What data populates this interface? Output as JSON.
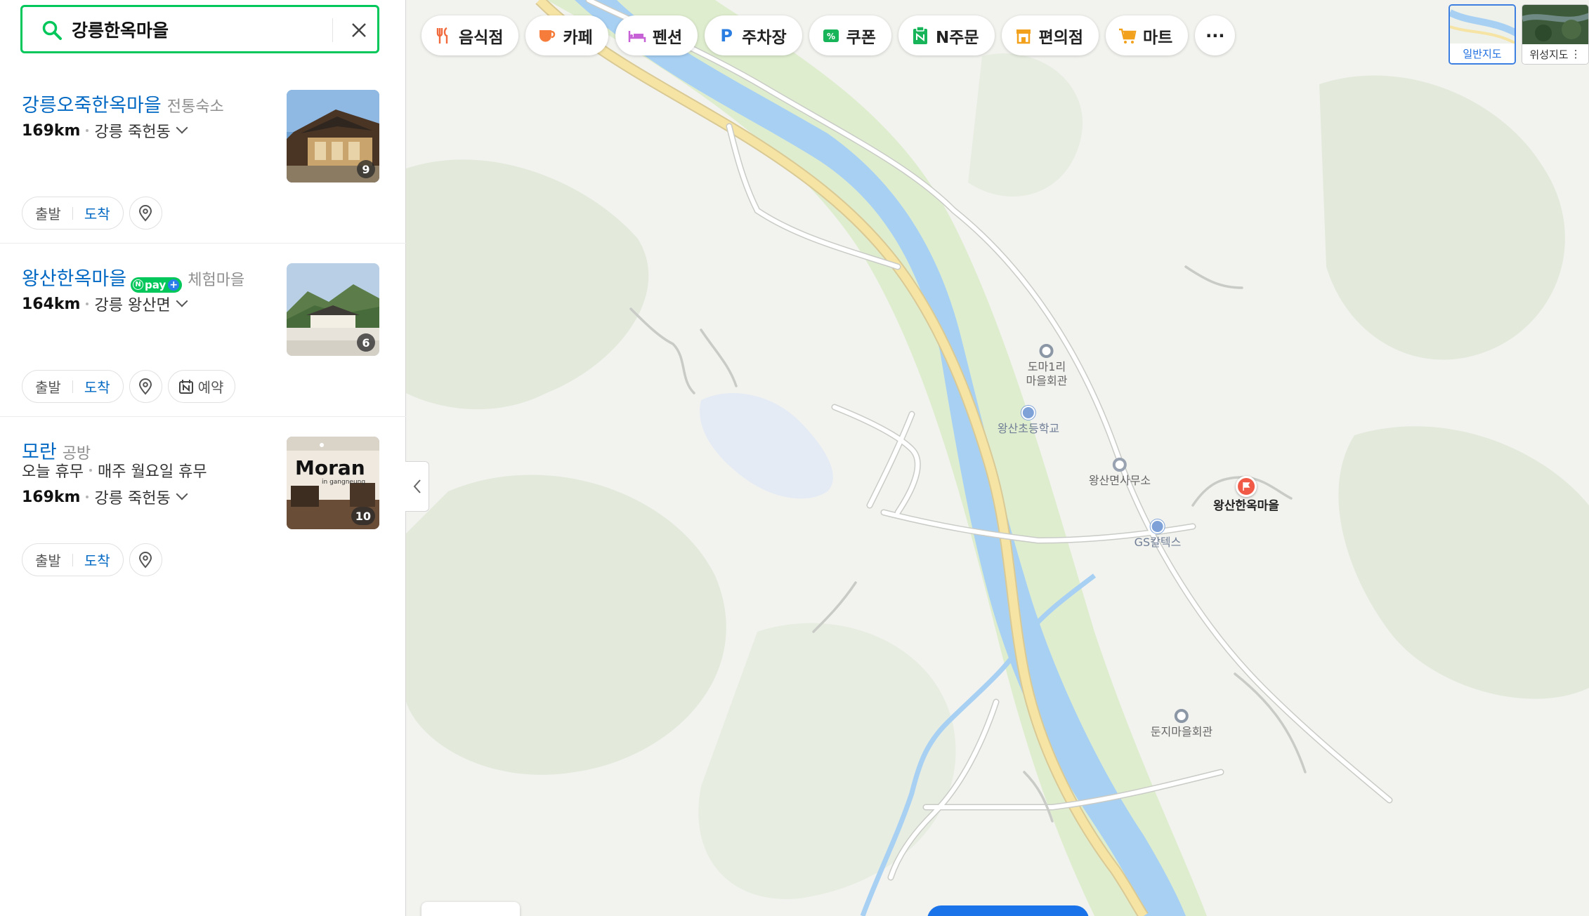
{
  "search": {
    "query": "강릉한옥마을",
    "placeholder": "",
    "clear_label": "검색어 지우기"
  },
  "results": [
    {
      "title": "강릉오죽한옥마을",
      "category": "전통숙소",
      "npay": false,
      "status": null,
      "distance": "169km",
      "area": "강릉 죽헌동",
      "photo_count": "9",
      "depart": "출발",
      "arrive": "도착",
      "reserve": null
    },
    {
      "title": "왕산한옥마을",
      "category": "체험마을",
      "npay": true,
      "status": null,
      "distance": "164km",
      "area": "강릉 왕산면",
      "photo_count": "6",
      "depart": "출발",
      "arrive": "도착",
      "reserve": "예약"
    },
    {
      "title": "모란",
      "category": "공방",
      "npay": false,
      "status": "오늘 휴무",
      "status_detail": "매주 월요일 휴무",
      "distance": "169km",
      "area": "강릉 죽헌동",
      "photo_count": "10",
      "photo_text": "Moran",
      "photo_subtext": "in gangneung",
      "depart": "출발",
      "arrive": "도착",
      "reserve": null
    }
  ],
  "npay_badge": {
    "n": "N",
    "text": "pay",
    "plus": "+"
  },
  "categories": [
    {
      "label": "음식점",
      "icon": "fork-knife-icon",
      "color": "#f06a3d"
    },
    {
      "label": "카페",
      "icon": "coffee-cup-icon",
      "color": "#f57c3a"
    },
    {
      "label": "펜션",
      "icon": "bed-icon",
      "color": "#c762d6"
    },
    {
      "label": "주차장",
      "icon": "parking-icon",
      "color": "#2a7de1"
    },
    {
      "label": "쿠폰",
      "icon": "coupon-icon",
      "color": "#17b45a"
    },
    {
      "label": "N주문",
      "icon": "order-icon",
      "color": "#17b45a"
    },
    {
      "label": "편의점",
      "icon": "store-icon",
      "color": "#f2a11d"
    },
    {
      "label": "마트",
      "icon": "cart-icon",
      "color": "#f2a11d"
    },
    {
      "label": "···",
      "icon": "more-icon",
      "color": "#555555"
    }
  ],
  "map_types": {
    "normal": "일반지도",
    "satellite": "위성지도"
  },
  "pois": {
    "doma": "도마1리\n마을회관",
    "school": "왕산초등학교",
    "office": "왕산면사무소",
    "gas": "GS칼텍스",
    "target": "왕산한옥마을",
    "dunji": "둔지마을회관"
  },
  "colors": {
    "brand_green": "#03c75a",
    "link_blue": "#0068c3",
    "river": "#a7d0f3",
    "road_main": "#f5df9a",
    "forest": "#e0ead9"
  }
}
